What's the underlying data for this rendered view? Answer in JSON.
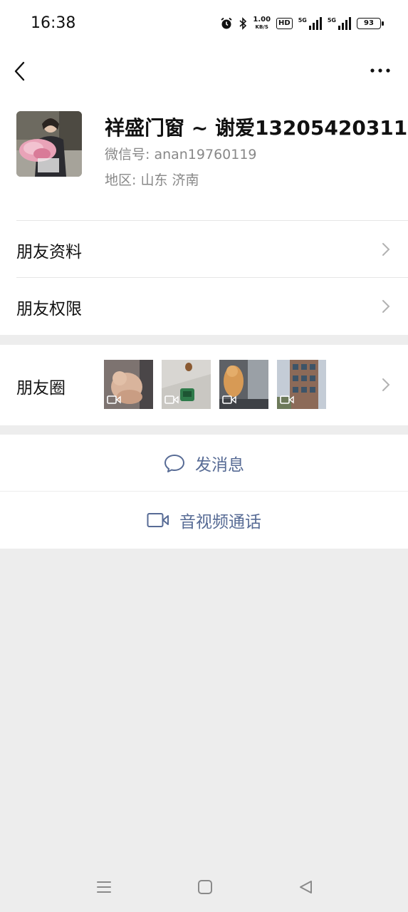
{
  "status_bar": {
    "time": "16:38",
    "net_speed_value": "1.00",
    "net_speed_unit": "KB/S",
    "hd_label": "HD",
    "sim1_label": "5G",
    "sim2_label": "5G",
    "battery": "93"
  },
  "header": {
    "back_icon": "chevron-left-icon",
    "more_icon": "more-horizontal-icon"
  },
  "profile": {
    "nickname": "祥盛门窗 ~ 谢爱13205420311",
    "wechat_id": "微信号: anan19760119",
    "region": "地区: 山东  济南",
    "badge_icon": "contact-person-icon",
    "badge_color": "#f08a5d"
  },
  "menu": {
    "friend_info": "朋友资料",
    "friend_permissions": "朋友权限",
    "moments": "朋友圈"
  },
  "moments_thumbnails": [
    {
      "subject": "fluffy dog on bed",
      "video": true
    },
    {
      "subject": "dog on floor with green object",
      "video": true
    },
    {
      "subject": "golden puppy in car",
      "video": true
    },
    {
      "subject": "apartment building",
      "video": true
    }
  ],
  "actions": {
    "send_message": "发消息",
    "video_call": "音视频通话"
  },
  "colors": {
    "link_blue": "#576b95",
    "background": "#ededed",
    "secondary_text": "#888888"
  }
}
